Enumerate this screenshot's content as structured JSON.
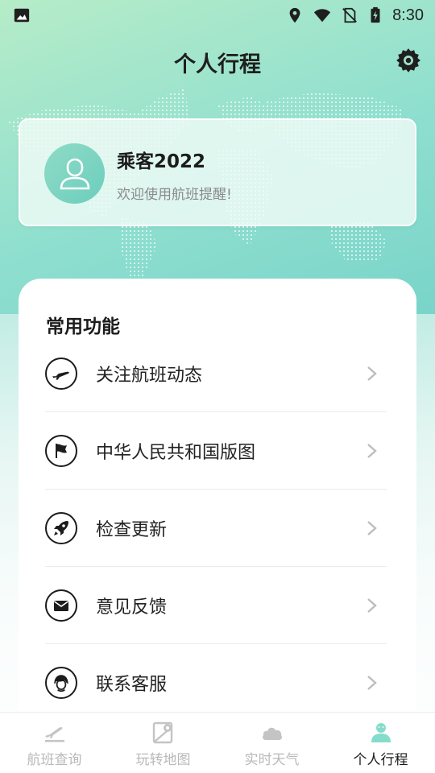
{
  "status_bar": {
    "time": "8:30",
    "icons": [
      "image-icon",
      "location-icon",
      "wifi-icon",
      "no-sim-icon",
      "battery-charging-icon"
    ]
  },
  "header": {
    "title": "个人行程",
    "settings_icon": "gear-icon"
  },
  "profile": {
    "username": "乘客2022",
    "welcome": "欢迎使用航班提醒!",
    "avatar_icon": "user-icon"
  },
  "functions": {
    "title": "常用功能",
    "items": [
      {
        "label": "关注航班动态",
        "icon": "plane-icon"
      },
      {
        "label": "中华人民共和国版图",
        "icon": "flag-icon"
      },
      {
        "label": "检查更新",
        "icon": "rocket-icon"
      },
      {
        "label": "意见反馈",
        "icon": "mail-icon"
      },
      {
        "label": "联系客服",
        "icon": "headset-icon"
      }
    ]
  },
  "tabs": [
    {
      "label": "航班查询",
      "icon": "plane-takeoff-icon",
      "active": false
    },
    {
      "label": "玩转地图",
      "icon": "map-icon",
      "active": false
    },
    {
      "label": "实时天气",
      "icon": "cloud-icon",
      "active": false
    },
    {
      "label": "个人行程",
      "icon": "person-icon",
      "active": true
    }
  ],
  "colors": {
    "accent": "#7fd6c8",
    "inactive_tab": "#b9b9b9",
    "text_primary": "#1c1c1c"
  }
}
